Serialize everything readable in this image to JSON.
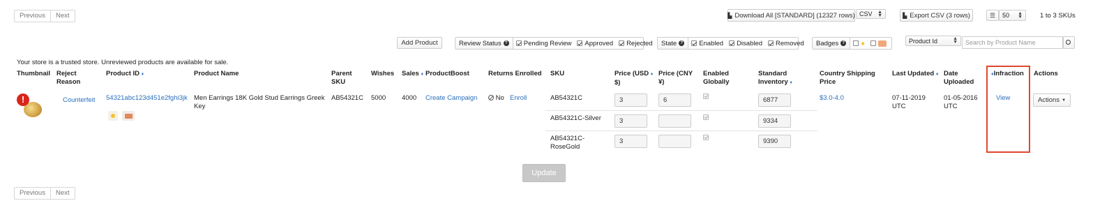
{
  "pager_top": {
    "previous": "Previous",
    "next": "Next"
  },
  "pager_bottom": {
    "previous": "Previous",
    "next": "Next"
  },
  "toolbar": {
    "download_all": "Download All [STANDARD] (12327 rows)",
    "download_format": "CSV",
    "export_csv": "Export CSV (3 rows)",
    "page_size": "50",
    "result_count": "1 to 3 SKUs"
  },
  "filters": {
    "add_product": "Add Product",
    "review_status_label": "Review Status",
    "review_options": [
      {
        "label": "Pending Review",
        "checked": true
      },
      {
        "label": "Approved",
        "checked": true
      },
      {
        "label": "Rejected",
        "checked": true
      }
    ],
    "state_label": "State",
    "state_options": [
      {
        "label": "Enabled",
        "checked": true
      },
      {
        "label": "Disabled",
        "checked": true
      },
      {
        "label": "Removed",
        "checked": true
      }
    ],
    "badges_label": "Badges",
    "search_field": "Product Id",
    "search_placeholder": "Search by Product Name"
  },
  "notice": "Your store is a trusted store. Unreviewed products are available for sale.",
  "columns": {
    "thumbnail": "Thumbnail",
    "reject_reason_1": "Reject",
    "reject_reason_2": "Reason",
    "product_id": "Product ID",
    "product_name": "Product Name",
    "parent_sku_1": "Parent",
    "parent_sku_2": "SKU",
    "wishes": "Wishes",
    "sales": "Sales",
    "productboost": "ProductBoost",
    "returns_enrolled": "Returns Enrolled",
    "sku": "SKU",
    "price_usd_1": "Price (USD",
    "price_usd_2": "$)",
    "price_cny_1": "Price (CNY",
    "price_cny_2": "¥)",
    "enabled_1": "Enabled",
    "enabled_2": "Globally",
    "inventory_1": "Standard",
    "inventory_2": "Inventory",
    "shipping_1": "Country Shipping",
    "shipping_2": "Price",
    "last_updated": "Last Updated",
    "date_uploaded_1": "Date",
    "date_uploaded_2": "Uploaded",
    "infraction": "Infraction",
    "actions": "Actions"
  },
  "product": {
    "reject_reason": "Counterfeit",
    "product_id": "54321abc123d451e2fghi3jk",
    "product_name": "Men Earrings 18K Gold Stud Earrings Greek Key",
    "parent_sku": "AB54321C",
    "wishes": "5000",
    "sales": "4000",
    "productboost": "Create Campaign",
    "returns_no": "No",
    "returns_enroll": "Enroll",
    "shipping_price": "$3.0-4.0",
    "last_updated_1": "07-11-2019",
    "last_updated_2": "UTC",
    "date_uploaded_1": "01-05-2016",
    "date_uploaded_2": "UTC",
    "infraction_link": "View",
    "actions_button": "Actions",
    "variants": [
      {
        "sku_1": "AB54321C",
        "sku_2": "",
        "price_usd": "3",
        "price_cny": "6",
        "inventory": "6877"
      },
      {
        "sku_1": "AB54321C-Silver",
        "sku_2": "",
        "price_usd": "3",
        "price_cny": "",
        "inventory": "9334"
      },
      {
        "sku_1": "AB54321C-",
        "sku_2": "RoseGold",
        "price_usd": "3",
        "price_cny": "",
        "inventory": "9390"
      }
    ]
  },
  "update_button": "Update",
  "colors": {
    "link": "#2a6ebb",
    "highlight": "#e0482c"
  }
}
